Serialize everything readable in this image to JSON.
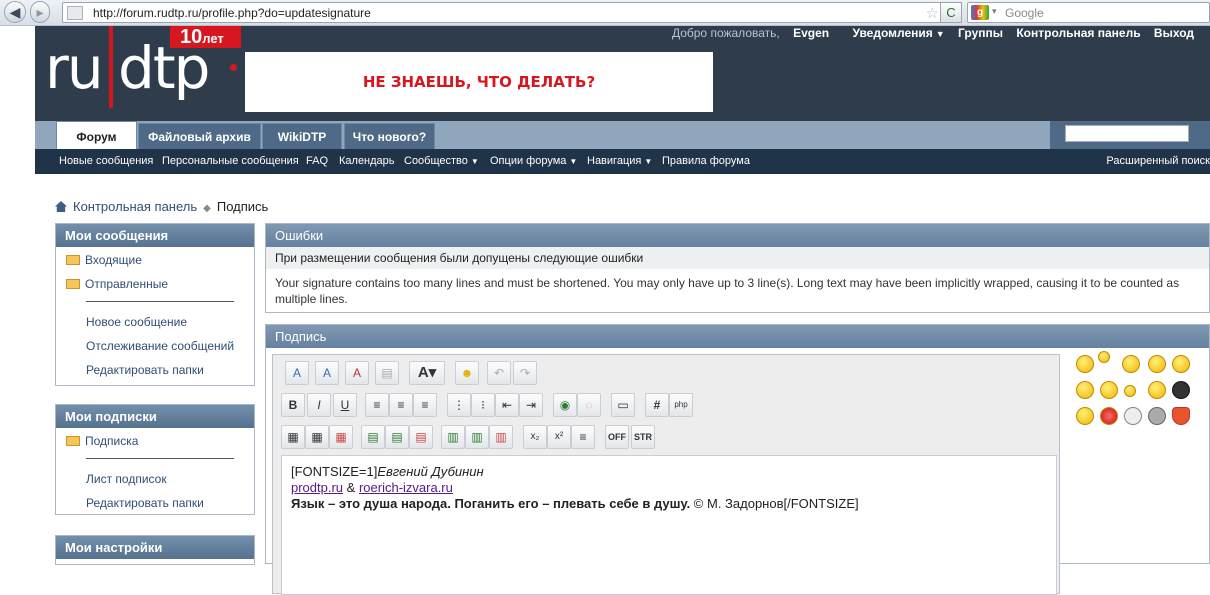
{
  "browser": {
    "url": "http://forum.rudtp.ru/profile.php?do=updatesignature",
    "search_placeholder": "Google"
  },
  "header": {
    "logo": "ru|dtp",
    "badge_num": "10",
    "badge_text": "лет",
    "banner": "НЕ ЗНАЕШЬ, ЧТО ДЕЛАТЬ?",
    "welcome": "Добро пожаловать,",
    "username": "Evgen",
    "notifications": "Уведомления",
    "groups": "Группы",
    "control_panel": "Контрольная панель",
    "logout": "Выход"
  },
  "tabs": [
    "Форум",
    "Файловый архив",
    "WikiDTP",
    "Что нового?"
  ],
  "subnav": [
    "Новые сообщения",
    "Персональные сообщения",
    "FAQ",
    "Календарь",
    "Сообщество",
    "Опции форума",
    "Навигация",
    "Правила форума"
  ],
  "advanced_search": "Расширенный поиск",
  "breadcrumb": {
    "parent": "Контрольная панель",
    "current": "Подпись"
  },
  "sidebar": {
    "messages": {
      "title": "Мои сообщения",
      "inbox": "Входящие",
      "sent": "Отправленные",
      "new": "Новое сообщение",
      "tracking": "Отслеживание сообщений",
      "edit_folders": "Редактировать папки"
    },
    "subscriptions": {
      "title": "Мои подписки",
      "subscription": "Подписка",
      "list": "Лист подписок",
      "edit_folders": "Редактировать папки"
    },
    "settings": {
      "title": "Мои настройки"
    }
  },
  "errors": {
    "title": "Ошибки",
    "subtitle": "При размещении сообщения были допущены следующие ошибки",
    "text": "Your signature contains too many lines and must be shortened. You may only have up to 3 line(s). Long text may have been implicitly wrapped, causing it to be counted as multiple lines."
  },
  "signature": {
    "title": "Подпись",
    "line1_code": "[FONTSIZE=1]",
    "line1_name": "Евгений Дубинин",
    "link1": "prodtp.ru",
    "amp": " & ",
    "link2": "roerich-izvara.ru",
    "line3_bold": "Язык – это душа народа. Поганить его – плевать себе в душу.",
    "line3_rest": " © М. Задорнов[/FONTSIZE]"
  }
}
